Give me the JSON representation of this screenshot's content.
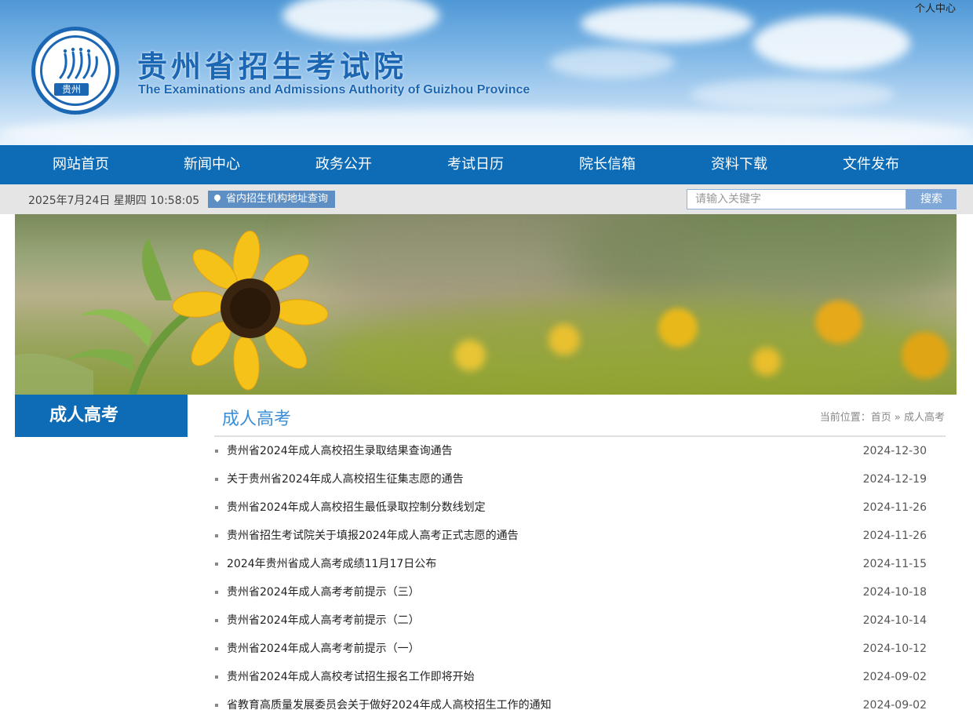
{
  "header": {
    "user_center": "个人中心",
    "logo_text": "贵州",
    "title": "贵州省招生考试院",
    "subtitle": "The Examinations and Admissions Authority of Guizhou Province"
  },
  "nav": {
    "items": [
      "网站首页",
      "新闻中心",
      "政务公开",
      "考试日历",
      "院长信箱",
      "资料下载",
      "文件发布"
    ]
  },
  "infobar": {
    "datetime": "2025年7月24日 星期四 10:58:05",
    "address_query": "省内招生机构地址查询",
    "search_placeholder": "请输入关键字",
    "search_button": "搜索"
  },
  "sidebar": {
    "title": "成人高考"
  },
  "main": {
    "section_title": "成人高考",
    "breadcrumb_label": "当前位置：",
    "breadcrumb_home": "首页",
    "breadcrumb_sep": " » ",
    "breadcrumb_current": "成人高考",
    "items": [
      {
        "title": "贵州省2024年成人高校招生录取结果查询通告",
        "date": "2024-12-30"
      },
      {
        "title": "关于贵州省2024年成人高校招生征集志愿的通告",
        "date": "2024-12-19"
      },
      {
        "title": "贵州省2024年成人高校招生最低录取控制分数线划定",
        "date": "2024-11-26"
      },
      {
        "title": "贵州省招生考试院关于填报2024年成人高考正式志愿的通告",
        "date": "2024-11-26"
      },
      {
        "title": "2024年贵州省成人高考成绩11月17日公布",
        "date": "2024-11-15"
      },
      {
        "title": "贵州省2024年成人高考考前提示（三）",
        "date": "2024-10-18"
      },
      {
        "title": "贵州省2024年成人高考考前提示（二）",
        "date": "2024-10-14"
      },
      {
        "title": "贵州省2024年成人高考考前提示（一）",
        "date": "2024-10-12"
      },
      {
        "title": "贵州省2024年成人高校考试招生报名工作即将开始",
        "date": "2024-09-02"
      },
      {
        "title": "省教育高质量发展委员会关于做好2024年成人高校招生工作的通知",
        "date": "2024-09-02"
      }
    ]
  },
  "colors": {
    "primary_blue": "#0e6cb6",
    "title_blue": "#1b67b3",
    "section_blue": "#3a8fd6"
  }
}
